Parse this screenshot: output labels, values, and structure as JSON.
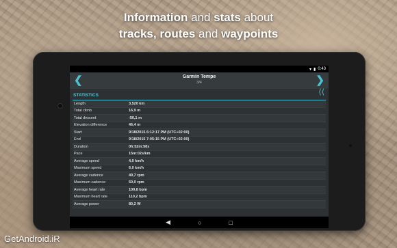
{
  "headline": {
    "line1_a": "Information",
    "line1_b": " and ",
    "line1_c": "stats",
    "line1_d": " about",
    "line2_a": "tracks, routes",
    "line2_b": " and ",
    "line2_c": "waypoints"
  },
  "statusbar": {
    "time": "0:43"
  },
  "titlebar": {
    "title": "Garmin Tempe",
    "page": "3/4"
  },
  "section": {
    "label": "STATISTICS"
  },
  "stats": [
    {
      "label": "Length",
      "value": "3,520 km"
    },
    {
      "label": "Total climb",
      "value": "16,9 m"
    },
    {
      "label": "Total descent",
      "value": "-50,1 m"
    },
    {
      "label": "Elevation difference",
      "value": "46,4 m"
    },
    {
      "label": "Start",
      "value": "9/18/2015 6:12:17 PM (UTC+02:00)"
    },
    {
      "label": "End",
      "value": "9/18/2015 7:05:15 PM (UTC+02:00)"
    },
    {
      "label": "Duration",
      "value": "0h:52m:58s"
    },
    {
      "label": "Pace",
      "value": "15m:02s/km"
    },
    {
      "label": "Average speed",
      "value": "4,0 km/h"
    },
    {
      "label": "Maximum speed",
      "value": "6,0 km/h"
    },
    {
      "label": "Average cadence",
      "value": "49,7 rpm"
    },
    {
      "label": "Maximum cadence",
      "value": "50,0 rpm"
    },
    {
      "label": "Average heart rate",
      "value": "109,8 bpm"
    },
    {
      "label": "Maximum heart rate",
      "value": "110,2 bpm"
    },
    {
      "label": "Average power",
      "value": "80,2 W"
    }
  ],
  "navbar": {
    "back": "◀",
    "home": "○",
    "recents": "□"
  },
  "watermark": "GetAndroid.iR"
}
